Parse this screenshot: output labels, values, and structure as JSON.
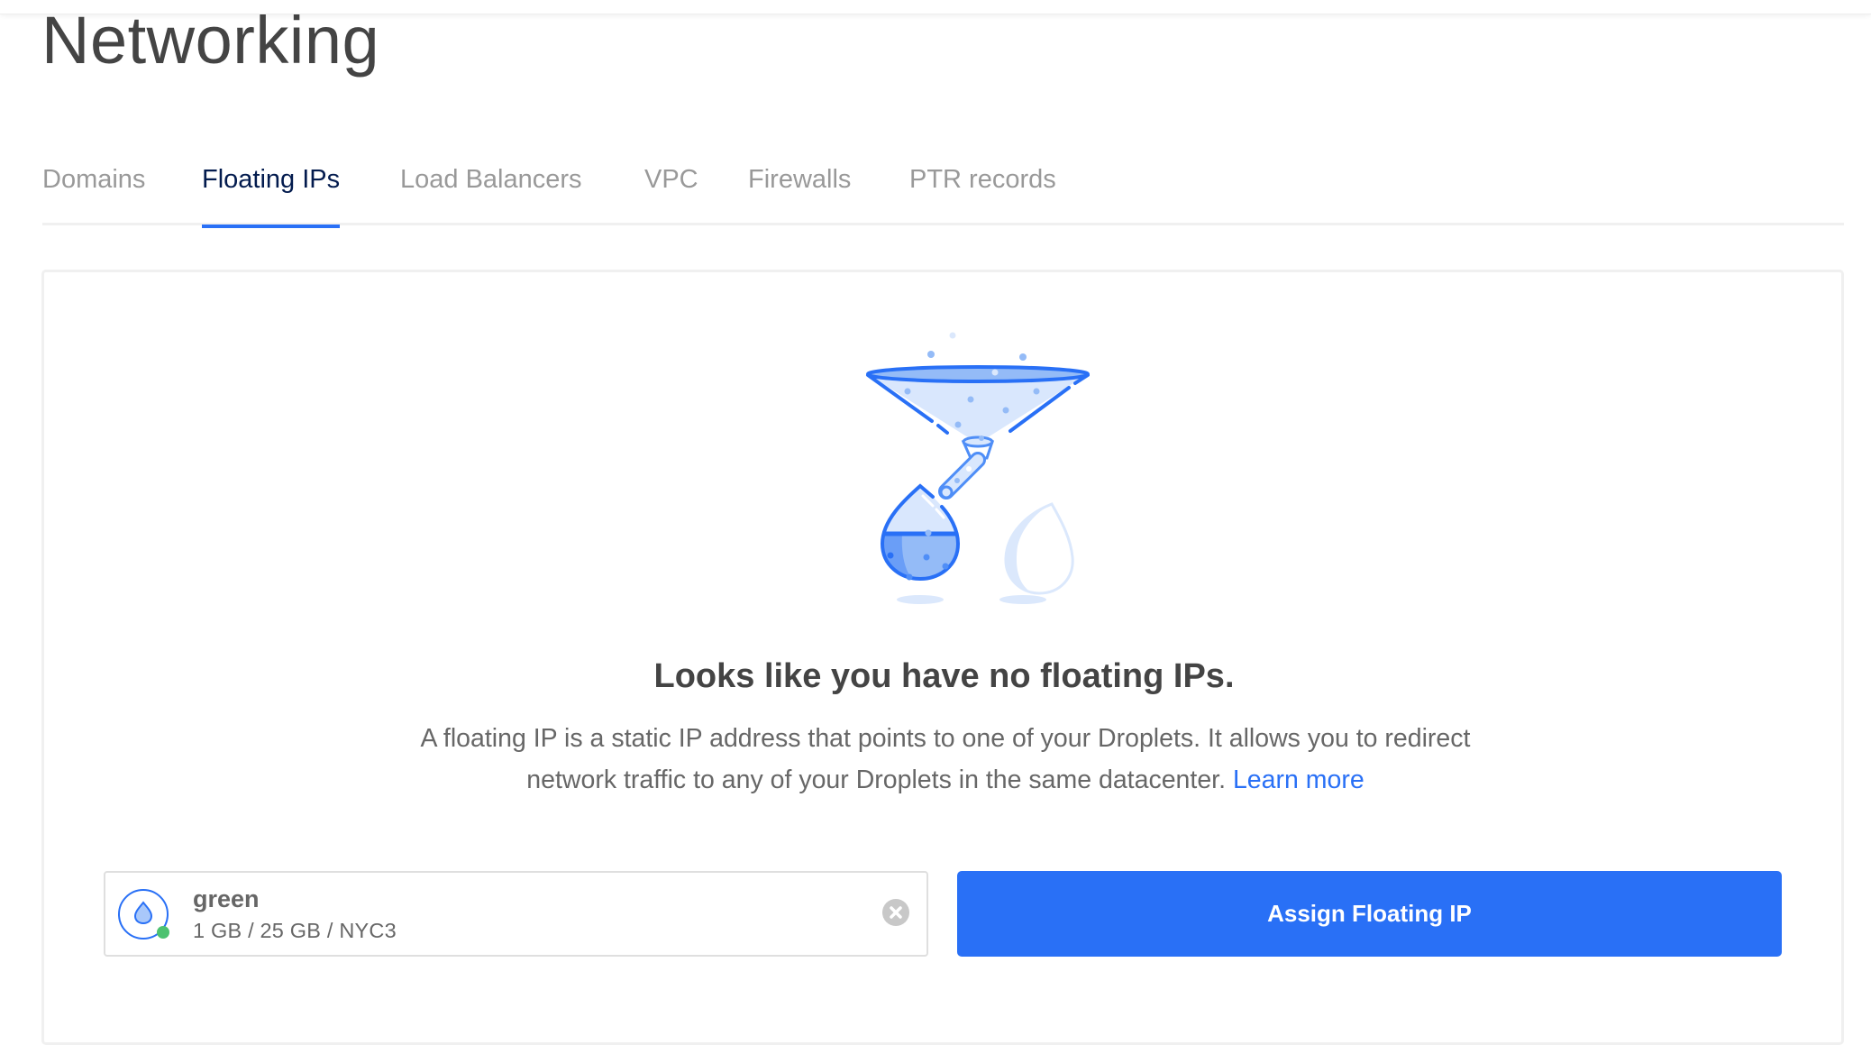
{
  "page": {
    "title": "Networking"
  },
  "tabs": [
    {
      "label": "Domains",
      "active": false
    },
    {
      "label": "Floating IPs",
      "active": true
    },
    {
      "label": "Load Balancers",
      "active": false
    },
    {
      "label": "VPC",
      "active": false
    },
    {
      "label": "Firewalls",
      "active": false
    },
    {
      "label": "PTR records",
      "active": false
    }
  ],
  "empty_state": {
    "illustration": "funnel-droplet-illustration",
    "title": "Looks like you have no floating IPs.",
    "description": "A floating IP is a static IP address that points to one of your Droplets. It allows you to redirect network traffic to any of your Droplets in the same datacenter.",
    "learn_more_label": "Learn more"
  },
  "droplet_selector": {
    "name": "green",
    "meta": "1 GB / 25 GB / NYC3",
    "status": "active",
    "status_color": "#4cc270",
    "icon": "droplet-icon",
    "clear_icon": "clear-icon"
  },
  "actions": {
    "assign_label": "Assign Floating IP"
  },
  "colors": {
    "accent": "#2970f6",
    "active_tab_text": "#031b4e",
    "inactive_tab_text": "#999999",
    "heading_text": "#444444",
    "body_text": "#676767"
  }
}
